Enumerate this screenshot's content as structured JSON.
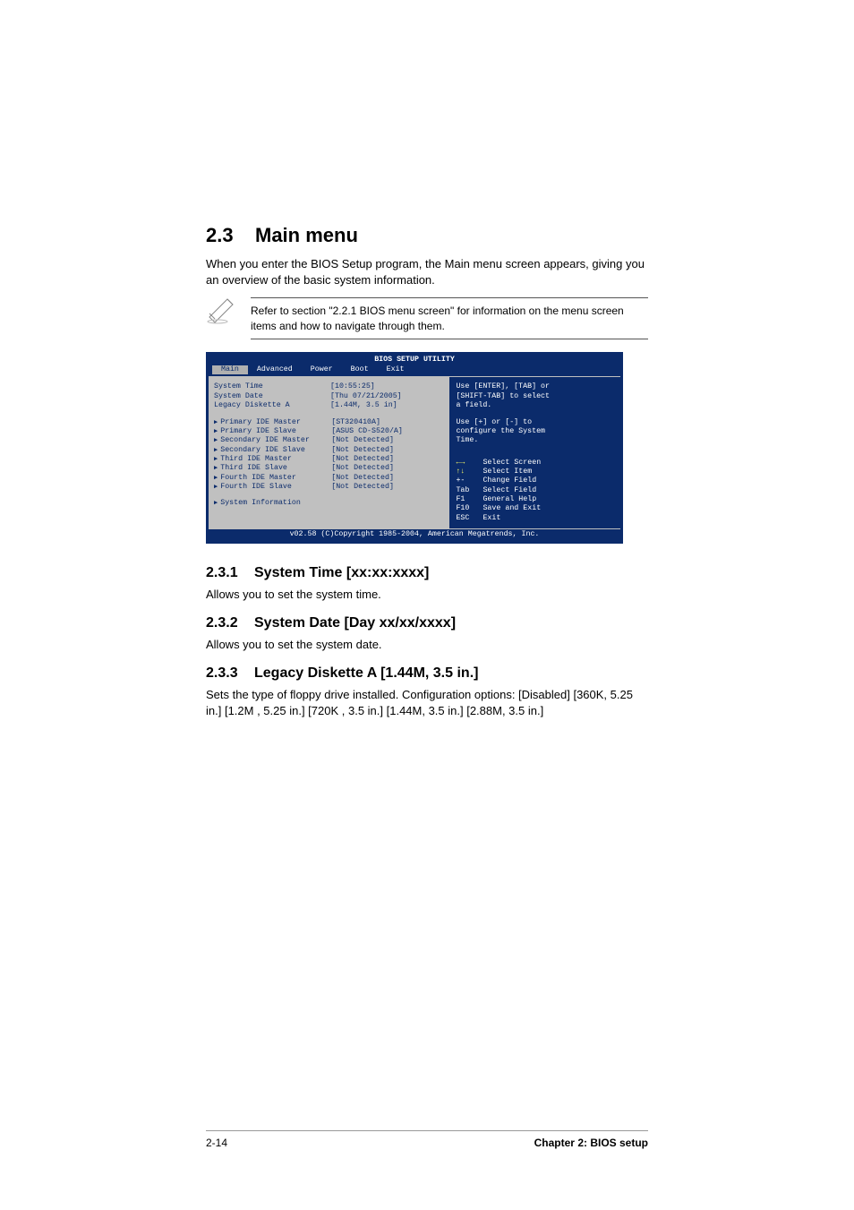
{
  "heading": {
    "number": "2.3",
    "title": "Main menu"
  },
  "intro": "When you enter the BIOS Setup program, the Main menu screen appears, giving you an overview of the basic system information.",
  "note": "Refer to section \"2.2.1  BIOS menu screen\" for information on the menu screen items and how to navigate through them.",
  "bios": {
    "title": "BIOS SETUP UTILITY",
    "tabs": [
      "Main",
      "Advanced",
      "Power",
      "Boot",
      "Exit"
    ],
    "active_tab": "Main",
    "rows_top": [
      {
        "label": "System Time",
        "value": "[10:55:25]"
      },
      {
        "label": "System Date",
        "value": "[Thu 07/21/2005]"
      },
      {
        "label": "Legacy Diskette A",
        "value": "[1.44M, 3.5 in]"
      }
    ],
    "rows_nav": [
      {
        "label": "Primary IDE Master",
        "value": "[ST320410A]"
      },
      {
        "label": "Primary IDE Slave",
        "value": "[ASUS CD-S520/A]"
      },
      {
        "label": "Secondary IDE Master",
        "value": "[Not Detected]"
      },
      {
        "label": "Secondary IDE Slave",
        "value": "[Not Detected]"
      },
      {
        "label": "Third IDE Master",
        "value": "[Not Detected]"
      },
      {
        "label": "Third IDE Slave",
        "value": "[Not Detected]"
      },
      {
        "label": "Fourth IDE Master",
        "value": "[Not Detected]"
      },
      {
        "label": "Fourth IDE Slave",
        "value": "[Not Detected]"
      }
    ],
    "sys_info": "System Information",
    "help_top1": "Use [ENTER], [TAB] or",
    "help_top2": "[SHIFT-TAB] to select",
    "help_top3": "a field.",
    "help_mid1": "Use [+] or [-] to",
    "help_mid2": "configure the System",
    "help_mid3": "Time.",
    "keys": [
      {
        "k": "←→",
        "d": "Select Screen"
      },
      {
        "k": "↑↓",
        "d": "Select Item"
      },
      {
        "k": "+-",
        "d": "Change Field"
      },
      {
        "k": "Tab",
        "d": "Select Field"
      },
      {
        "k": "F1",
        "d": "General Help"
      },
      {
        "k": "F10",
        "d": "Save and Exit"
      },
      {
        "k": "ESC",
        "d": "Exit"
      }
    ],
    "footer": "v02.58 (C)Copyright 1985-2004, American Megatrends, Inc."
  },
  "sub1": {
    "num": "2.3.1",
    "title": "System Time [xx:xx:xxxx]",
    "text": "Allows you to set the system time."
  },
  "sub2": {
    "num": "2.3.2",
    "title": "System Date [Day xx/xx/xxxx]",
    "text": "Allows you to set the system date."
  },
  "sub3": {
    "num": "2.3.3",
    "title": "Legacy Diskette A [1.44M, 3.5 in.]",
    "text": "Sets the type of floppy drive installed. Configuration options: [Disabled] [360K, 5.25 in.] [1.2M , 5.25 in.] [720K , 3.5 in.] [1.44M, 3.5 in.] [2.88M, 3.5 in.]"
  },
  "footer": {
    "left": "2-14",
    "right": "Chapter 2: BIOS setup"
  }
}
